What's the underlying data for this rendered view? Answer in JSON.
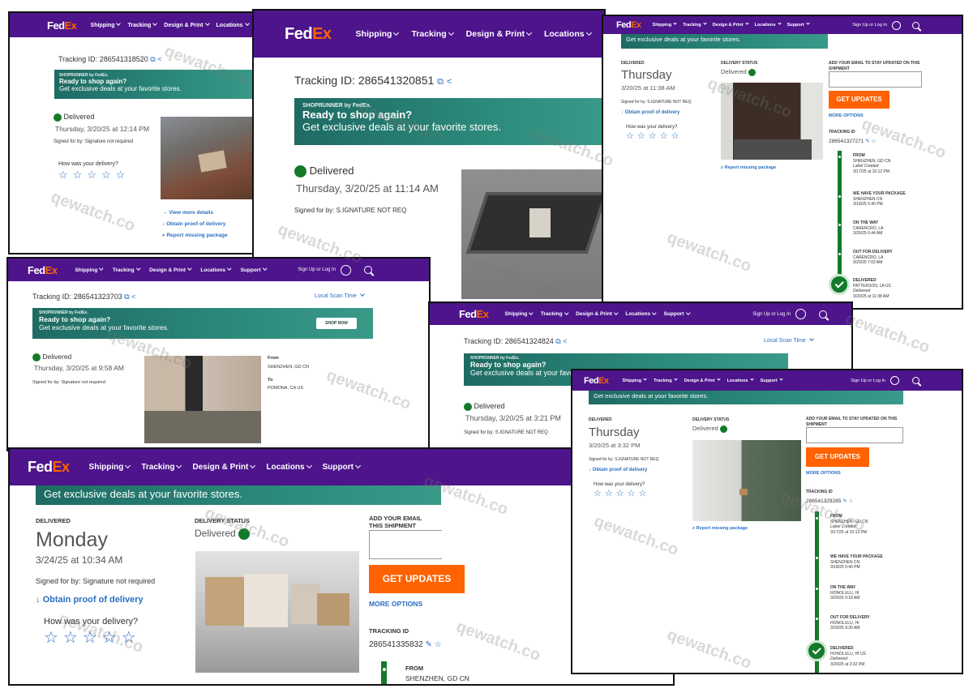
{
  "brand": {
    "fed": "Fed",
    "ex": "Ex",
    "purple": "#4d148c",
    "orange": "#ff6200",
    "green": "#137a2a"
  },
  "nav": {
    "shipping": "Shipping",
    "tracking": "Tracking",
    "design_print": "Design & Print",
    "locations": "Locations",
    "support": "Support",
    "sign_in": "Sign Up or Log In"
  },
  "common": {
    "shoprunner": "SHOPRUNNER",
    "by_fedex": "by FedEx.",
    "ready": "Ready to shop again?",
    "deals": "Get exclusive deals at your favorite stores.",
    "shop_now": "SHOP NOW",
    "delivered": "Delivered",
    "delivered_cap": "DELIVERED",
    "delivery_status": "DELIVERY STATUS",
    "how_was": "How was your delivery?",
    "obtain_pod": "Obtain proof of delivery",
    "obtain_pod_alt": "Obtain proof of delivery",
    "view_details": "View more details",
    "report_missing": "Report missing package",
    "add_email": "ADD YOUR EMAIL TO STAY UPDATED ON THIS SHIPMENT",
    "add_email_cut": "ADD YOUR EMAIL THIS SHIPMENT",
    "get_updates": "GET UPDATES",
    "more_options": "MORE OPTIONS",
    "tracking_id_cap": "TRACKING ID",
    "tracking_id_label": "Tracking ID:",
    "local_scan": "Local Scan Time",
    "from": "From",
    "to": "To",
    "from_cap": "FROM",
    "label_created": "Label Created",
    "we_have": "WE HAVE YOUR PACKAGE",
    "on_the_way": "ON THE WAY",
    "out_for_delivery": "OUT FOR DELIVERY",
    "delivered_tl": "DELIVERED",
    "delivered_italic": "Delivered"
  },
  "watermark": "qewatch.co",
  "s1": {
    "tracking_id": "286541318520",
    "date": "Thursday, 3/20/25 at 12:14 PM",
    "signed": "Signed for by: Signature not required"
  },
  "s2": {
    "tracking_id": "286541320851",
    "date": "Thursday, 3/20/25 at 11:14 AM",
    "signed": "Signed for by: S.IGNATURE NOT REQ"
  },
  "s3": {
    "day": "Thursday",
    "datetime": "3/20/25 at 11:38 AM",
    "signed": "Signed for by: S.IGNATURE NOT REQ",
    "tracking_id": "286541327271",
    "timeline": [
      {
        "label": "FROM",
        "place": "SHENZHEN, GD CN",
        "sub": "Label Created",
        "time": "3/17/25 at 10:12 PM"
      },
      {
        "label": "WE HAVE YOUR PACKAGE",
        "place": "SHENZHEN CN",
        "sub": "",
        "time": "3/18/25 5:40 PM"
      },
      {
        "label": "ON THE WAY",
        "place": "CARENCRO, LA",
        "sub": "",
        "time": "3/20/25 6:44 AM"
      },
      {
        "label": "OUT FOR DELIVERY",
        "place": "CARENCRO, LA",
        "sub": "",
        "time": "3/20/25 7:03 AM"
      },
      {
        "label": "DELIVERED",
        "place": "PATTERSON, LA US",
        "sub": "Delivered",
        "time": "3/20/25 at 11:38 AM"
      }
    ]
  },
  "s4": {
    "tracking_id": "286541323703",
    "date": "Thursday, 3/20/25 at 9:58 AM",
    "signed": "Signed for by: Signature not required",
    "from_place": "SHENZHEN, GD CN",
    "to_place": "POMONA, CA US"
  },
  "s5": {
    "tracking_id": "286541324824",
    "date": "Thursday, 3/20/25 at 3:21 PM",
    "signed": "Signed for by: S.IGNATURE NOT REQ"
  },
  "s6": {
    "day": "Monday",
    "datetime": "3/24/25 at 10:34 AM",
    "signed": "Signed for by: Signature not required",
    "tracking_id": "286541335832",
    "from_place": "SHENZHEN, GD CN"
  },
  "s7": {
    "day": "Thursday",
    "datetime": "3/20/25 at 3:32 PM",
    "signed": "Signed for by: S.IGNATURE NOT REQ",
    "tracking_id": "286541329285",
    "timeline": [
      {
        "label": "FROM",
        "place": "SHENZHEN, GD CN",
        "sub": "Label Created",
        "time": "3/17/25 at 10:13 PM"
      },
      {
        "label": "WE HAVE YOUR PACKAGE",
        "place": "SHENZHEN CN",
        "sub": "",
        "time": "3/18/25 5:40 PM"
      },
      {
        "label": "ON THE WAY",
        "place": "HONOLULU, HI",
        "sub": "",
        "time": "3/20/25 9:18 AM"
      },
      {
        "label": "OUT FOR DELIVERY",
        "place": "HONOLULU, HI",
        "sub": "",
        "time": "3/20/25 9:30 AM"
      },
      {
        "label": "DELIVERED",
        "place": "HONOLULU, HI US",
        "sub": "Delivered",
        "time": "3/20/25 at 3:32 PM"
      }
    ]
  }
}
